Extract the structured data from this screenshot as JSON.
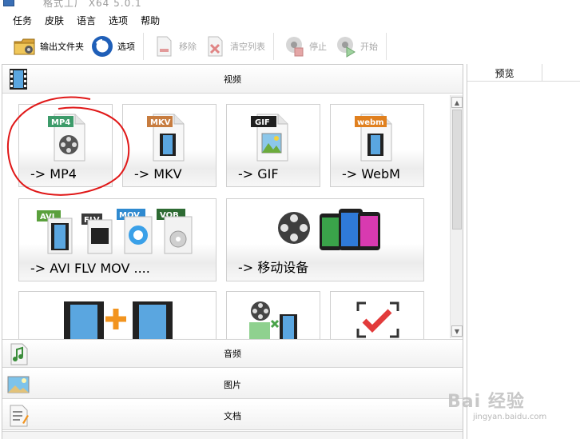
{
  "app": {
    "title": "格式工厂 X64 5.0.1"
  },
  "menu": [
    {
      "label": "任务",
      "name": "menu-task"
    },
    {
      "label": "皮肤",
      "name": "menu-skin"
    },
    {
      "label": "语言",
      "name": "menu-language"
    },
    {
      "label": "选项",
      "name": "menu-options"
    },
    {
      "label": "帮助",
      "name": "menu-help"
    }
  ],
  "toolbar": {
    "output_folder": "输出文件夹",
    "options": "选项",
    "remove": "移除",
    "clear_list": "清空列表",
    "stop": "停止",
    "start": "开始"
  },
  "sections": {
    "video": "视频",
    "audio": "音频",
    "image": "图片",
    "document": "文档"
  },
  "video_tiles": [
    {
      "label": "-> MP4",
      "badge": "MP4",
      "badge_color": "#3d9b6a"
    },
    {
      "label": "-> MKV",
      "badge": "MKV",
      "badge_color": "#c77c3f"
    },
    {
      "label": "-> GIF",
      "badge": "GIF",
      "badge_color": "#1f1f1f"
    },
    {
      "label": "-> WebM",
      "badge": "webm",
      "badge_color": "#e0801f"
    },
    {
      "label": "-> AVI FLV MOV ....",
      "badges": [
        "AVI",
        "FLV",
        "MOV",
        "VOB"
      ]
    },
    {
      "label": "-> 移动设备"
    }
  ],
  "preview": {
    "column": "预览"
  },
  "watermark": {
    "brand": "Bai 经验",
    "url": "jingyan.baidu.com"
  },
  "colors": {
    "annotation": "#e01818",
    "accent_orange": "#f2941f",
    "check_red": "#e23b3b"
  }
}
